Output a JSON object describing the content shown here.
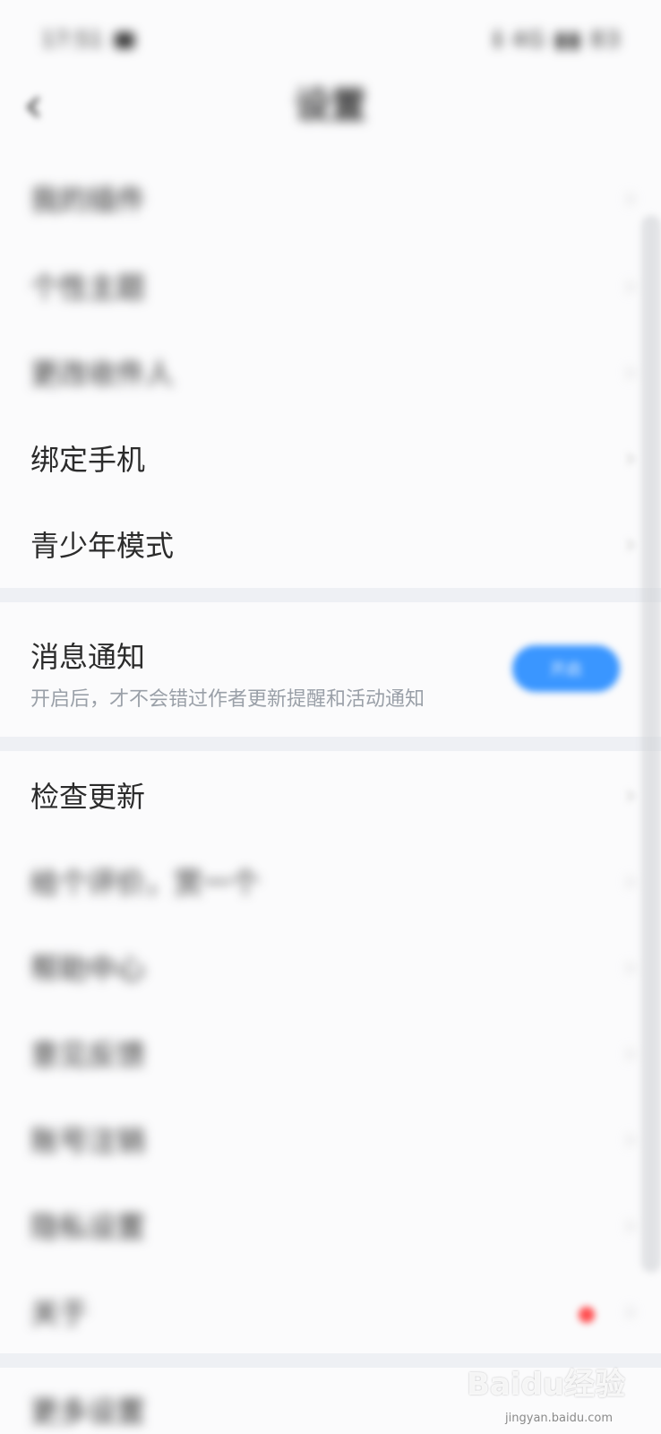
{
  "status_bar": {
    "time": "17:51",
    "right": "ℹ 4G ▮▮ 83"
  },
  "header": {
    "title": "设置"
  },
  "menu_items": [
    {
      "label": "我的插件"
    },
    {
      "label": "个性主题"
    },
    {
      "label": "更改收件人"
    },
    {
      "label": "绑定手机"
    },
    {
      "label": "青少年模式"
    }
  ],
  "notification": {
    "title": "消息通知",
    "description": "开启后，才不会错过作者更新提醒和活动通知",
    "toggle_label": "开启"
  },
  "menu_items_2": [
    {
      "label": "检查更新"
    },
    {
      "label": "给个评价，赏一个"
    },
    {
      "label": "帮助中心"
    },
    {
      "label": "意见反馈"
    },
    {
      "label": "账号注销"
    },
    {
      "label": "隐私设置"
    },
    {
      "label": "关于"
    }
  ],
  "bottom": {
    "label": "更多设置"
  },
  "watermark": {
    "brand": "Baidu经验",
    "sub": "jingyan.baidu.com"
  },
  "colors": {
    "accent": "#3a96ff",
    "badge": "#ff4d4f",
    "divider": "#eef0f4"
  }
}
